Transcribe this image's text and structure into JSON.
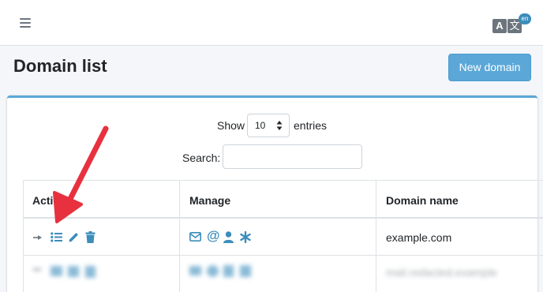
{
  "header": {
    "menu_icon": "hamburger-icon",
    "lang_badge": "en",
    "lang_icon": "translate-icon",
    "lang_a": "A",
    "lang_x": "文"
  },
  "page": {
    "title": "Domain list",
    "new_button": "New domain"
  },
  "controls": {
    "show_label": "Show",
    "entries_value": "10",
    "entries_label": "entries",
    "search_label": "Search:",
    "search_value": ""
  },
  "table": {
    "columns": [
      "Action",
      "Manage",
      "Domain name"
    ],
    "rows": [
      {
        "domain": "example.com"
      },
      {
        "domain": "mail.redacted.example"
      }
    ]
  },
  "colors": {
    "accent": "#5aa7d8",
    "icon": "#3c8dbc",
    "arrow": "#e8313f"
  }
}
